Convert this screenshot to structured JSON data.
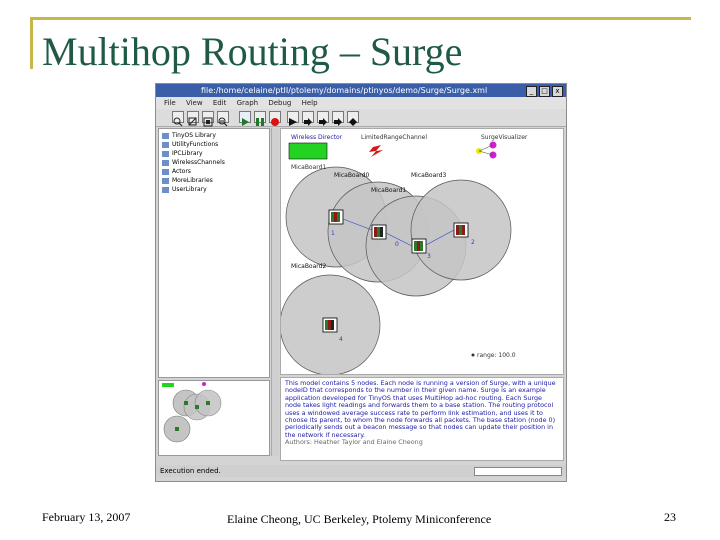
{
  "slide": {
    "title": "Multihop Routing – Surge",
    "date": "February 13, 2007",
    "footer_center": "Elaine Cheong, UC Berkeley, Ptolemy Miniconference",
    "page_number": "23"
  },
  "window": {
    "title": "file:/home/celaine/ptII/ptolemy/domains/ptinyos/demo/Surge/Surge.xml",
    "buttons": [
      "_",
      "□",
      "x"
    ]
  },
  "menu": [
    "File",
    "View",
    "Edit",
    "Graph",
    "Debug",
    "Help"
  ],
  "toolbar": {
    "icons": [
      "zoom-in-icon",
      "zoom-reset-icon",
      "zoom-fit-icon",
      "zoom-out-icon",
      "run-icon",
      "pause-icon",
      "stop-icon",
      "arrow-icon",
      "arrow-icon",
      "arrow-icon",
      "arrow-icon",
      "diamond-icon"
    ]
  },
  "tree": {
    "items": [
      "TinyOS Library",
      "UtilityFunctions",
      "IPCLibrary",
      "WirelessChannels",
      "Actors",
      "MoreLibraries",
      "UserLibrary"
    ]
  },
  "canvas": {
    "labels": {
      "director": "Wireless Director",
      "channel": "LimitedRangeChannel",
      "surge_rule": "SurgeVisualizer",
      "mica_board1": "MicaBoard1",
      "mica_board0": "MicaBoard0",
      "mica_board3": "MicaBoard3",
      "mica_board2": "MicaBoard2",
      "mica_board4": "MicaBoard4",
      "range": "range: 100.0"
    },
    "node_ids": [
      "0",
      "1",
      "2",
      "3",
      "4"
    ],
    "colors": {
      "range_fill": "#c4c4c4",
      "range_stroke": "#555555",
      "director_green": "#22d322",
      "surge_magenta": "#d020d0",
      "surge_yellow": "#e8e800",
      "node_blue": "#2b3fc8"
    }
  },
  "docs": {
    "text": "This model contains 5 nodes. Each node is running a version of Surge, with a unique nodeID that corresponds to the number in their given name. Surge is an example application developed for TinyOS that uses MultiHop ad-hoc routing. Each Surge node takes light readings and forwards them to a base station. The routing protocol uses a windowed average success rate to perform link estimation, and uses it to choose its parent, to whom the node forwards all packets. The base station (node 0) periodically sends out a beacon message so that nodes can update their position in the network if necessary.",
    "authors": "Authors: Heather Taylor and Elaine Cheong"
  },
  "status": {
    "text": "Execution ended."
  }
}
